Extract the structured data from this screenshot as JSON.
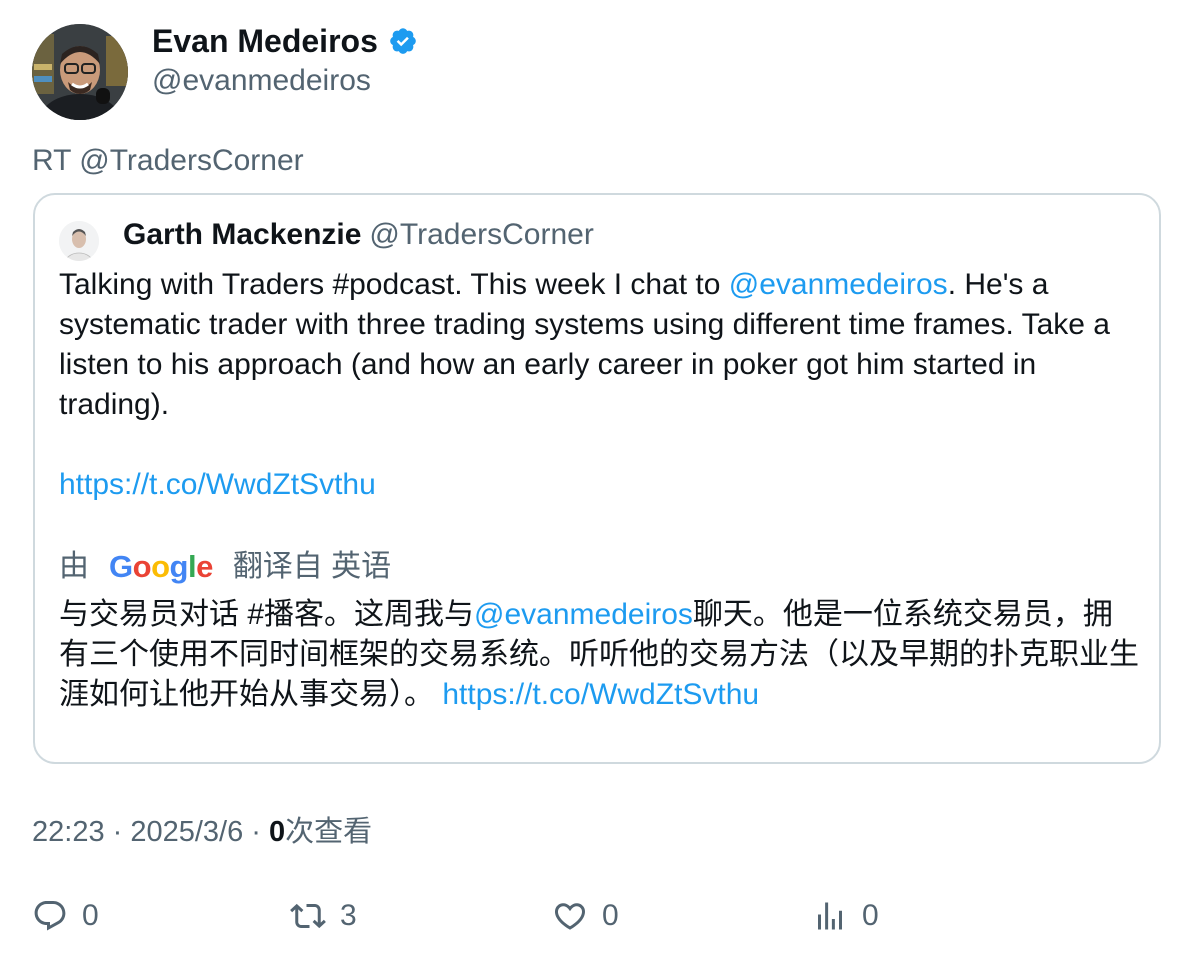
{
  "author": {
    "name": "Evan Medeiros",
    "handle": "@evanmedeiros",
    "verified_color": "#1d9bf0"
  },
  "retweet_line": "RT @TradersCorner",
  "quoted": {
    "name": "Garth Mackenzie",
    "handle": "@TradersCorner",
    "text_before_mention": "Talking with Traders #podcast. This week I chat to ",
    "mention": "@evanmedeiros",
    "text_after_mention": ". He's a systematic trader with three trading systems using different time frames. Take a listen to his approach (and how an early career in poker got him started in trading).",
    "url": "https://t.co/WwdZtSvthu",
    "translate_prefix": "由",
    "translate_brand": "Google",
    "translate_suffix": "翻译自 英语",
    "translated_before_mention": "与交易员对话 #播客。这周我与",
    "translated_mention": "@evanmedeiros",
    "translated_after_mention": "聊天。他是一位系统交易员，拥有三个使用不同时间框架的交易系统。听听他的交易方法（以及早期的扑克职业生涯如何让他开始从事交易）。 ",
    "translated_url": "https://t.co/WwdZtSvthu"
  },
  "meta": {
    "time": "22:23",
    "date": "2025/3/6",
    "views_count": "0",
    "views_label": "次查看"
  },
  "actions": {
    "reply_count": "0",
    "retweet_count": "3",
    "like_count": "0",
    "views_count": "0"
  },
  "colors": {
    "link": "#1d9bf0",
    "secondary_text": "#536471",
    "border": "#cfd9de"
  }
}
